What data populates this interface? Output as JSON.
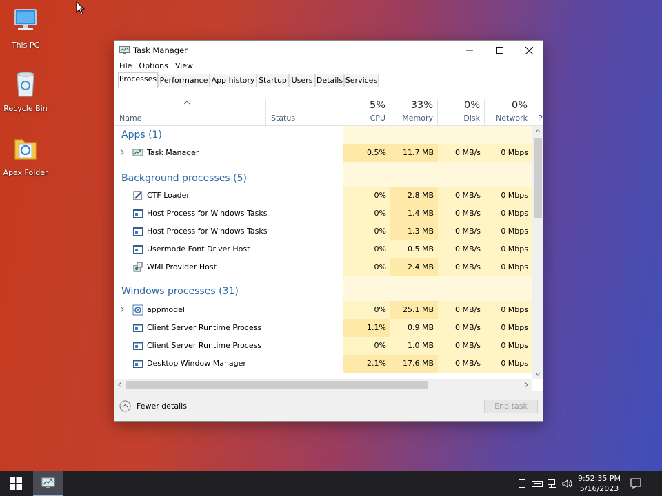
{
  "desktop": {
    "icons": [
      {
        "label": "This PC"
      },
      {
        "label": "Recycle Bin"
      },
      {
        "label": "Apex Folder"
      }
    ]
  },
  "window": {
    "title": "Task Manager",
    "menu": [
      "File",
      "Options",
      "View"
    ],
    "tabs": [
      "Processes",
      "Performance",
      "App history",
      "Startup",
      "Users",
      "Details",
      "Services"
    ],
    "active_tab": "Processes"
  },
  "columns": {
    "name": "Name",
    "status": "Status",
    "cpu": {
      "pct": "5%",
      "label": "CPU"
    },
    "memory": {
      "pct": "33%",
      "label": "Memory"
    },
    "disk": {
      "pct": "0%",
      "label": "Disk"
    },
    "network": {
      "pct": "0%",
      "label": "Network"
    },
    "power_cut": "P"
  },
  "groups": {
    "apps": "Apps (1)",
    "background": "Background processes (5)",
    "windows": "Windows processes (31)"
  },
  "processes": {
    "apps": [
      {
        "name": "Task Manager",
        "cpu": "0.5%",
        "mem": "11.7 MB",
        "disk": "0 MB/s",
        "net": "0 Mbps"
      }
    ],
    "background": [
      {
        "name": "CTF Loader",
        "cpu": "0%",
        "mem": "2.8 MB",
        "disk": "0 MB/s",
        "net": "0 Mbps"
      },
      {
        "name": "Host Process for Windows Tasks",
        "cpu": "0%",
        "mem": "1.4 MB",
        "disk": "0 MB/s",
        "net": "0 Mbps"
      },
      {
        "name": "Host Process for Windows Tasks",
        "cpu": "0%",
        "mem": "1.3 MB",
        "disk": "0 MB/s",
        "net": "0 Mbps"
      },
      {
        "name": "Usermode Font Driver Host",
        "cpu": "0%",
        "mem": "0.5 MB",
        "disk": "0 MB/s",
        "net": "0 Mbps"
      },
      {
        "name": "WMI Provider Host",
        "cpu": "0%",
        "mem": "2.4 MB",
        "disk": "0 MB/s",
        "net": "0 Mbps"
      }
    ],
    "windows": [
      {
        "name": "appmodel",
        "cpu": "0%",
        "mem": "25.1 MB",
        "disk": "0 MB/s",
        "net": "0 Mbps"
      },
      {
        "name": "Client Server Runtime Process",
        "cpu": "1.1%",
        "mem": "0.9 MB",
        "disk": "0 MB/s",
        "net": "0 Mbps"
      },
      {
        "name": "Client Server Runtime Process",
        "cpu": "0%",
        "mem": "1.0 MB",
        "disk": "0 MB/s",
        "net": "0 Mbps"
      },
      {
        "name": "Desktop Window Manager",
        "cpu": "2.1%",
        "mem": "17.6 MB",
        "disk": "0 MB/s",
        "net": "0 Mbps"
      }
    ]
  },
  "footer": {
    "fewer_details": "Fewer details",
    "end_task": "End task"
  },
  "taskbar": {
    "time": "9:52:35 PM",
    "date": "5/16/2023"
  },
  "colors": {
    "group_title": "#2a68a8",
    "cell_light": "#fff4c4",
    "cell_dark": "#ffe9a8"
  }
}
